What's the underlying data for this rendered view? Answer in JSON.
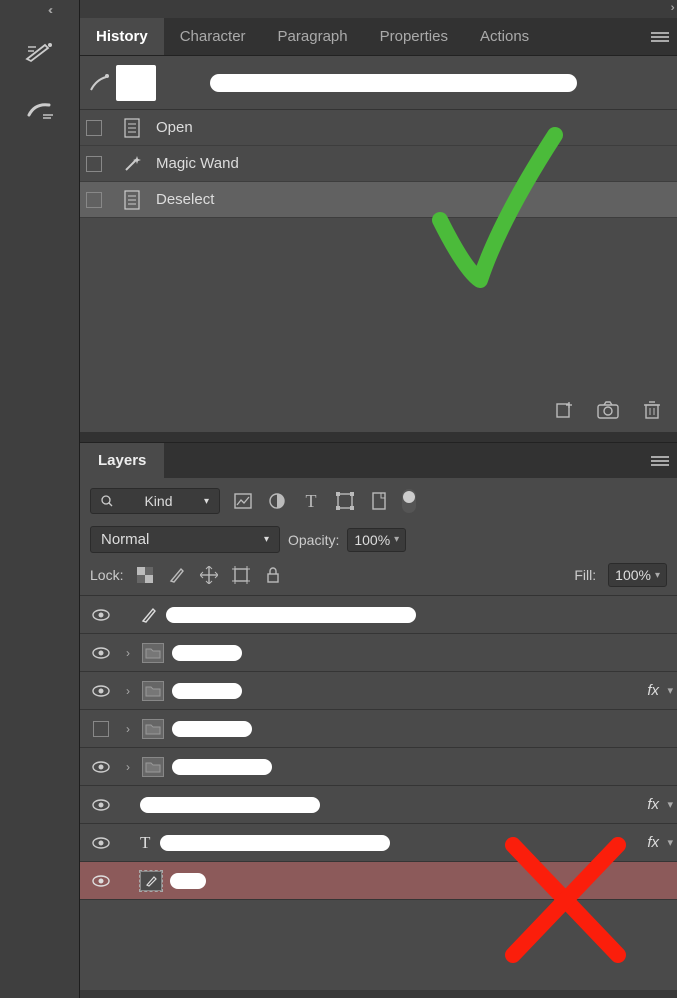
{
  "tabs": [
    "History",
    "Character",
    "Paragraph",
    "Properties",
    "Actions"
  ],
  "history": {
    "doc_thumbnail": "doc",
    "items": [
      {
        "icon": "file",
        "label": "Open"
      },
      {
        "icon": "wand",
        "label": "Magic Wand"
      },
      {
        "icon": "file",
        "label": "Deselect",
        "selected": true
      }
    ],
    "footer_icons": [
      "new-from-state",
      "snapshot",
      "trash"
    ]
  },
  "layers_panel": {
    "title": "Layers",
    "filter": {
      "kind_label": "Kind",
      "filter_icons": [
        "image",
        "adjustment",
        "type",
        "shape",
        "smart"
      ]
    },
    "blend": {
      "mode": "Normal",
      "opacity_label": "Opacity:",
      "opacity": "100%"
    },
    "lock": {
      "label": "Lock:",
      "fill_label": "Fill:",
      "fill": "100%",
      "icons": [
        "transparent",
        "brush",
        "move",
        "crop",
        "lock"
      ]
    },
    "layers": [
      {
        "vis": true,
        "type": "brush",
        "fx": false,
        "indent": 0
      },
      {
        "vis": true,
        "type": "group",
        "fx": false,
        "indent": 0,
        "disclosure": true
      },
      {
        "vis": true,
        "type": "group",
        "fx": true,
        "indent": 0,
        "disclosure": true
      },
      {
        "vis": false,
        "type": "group",
        "fx": false,
        "indent": 0,
        "disclosure": true
      },
      {
        "vis": true,
        "type": "group",
        "fx": false,
        "indent": 0,
        "disclosure": true
      },
      {
        "vis": true,
        "type": "plain",
        "fx": true,
        "indent": 0
      },
      {
        "vis": true,
        "type": "text",
        "fx": true,
        "indent": 0
      },
      {
        "vis": true,
        "type": "brush-sel",
        "fx": false,
        "indent": 0,
        "selected": true
      }
    ]
  }
}
